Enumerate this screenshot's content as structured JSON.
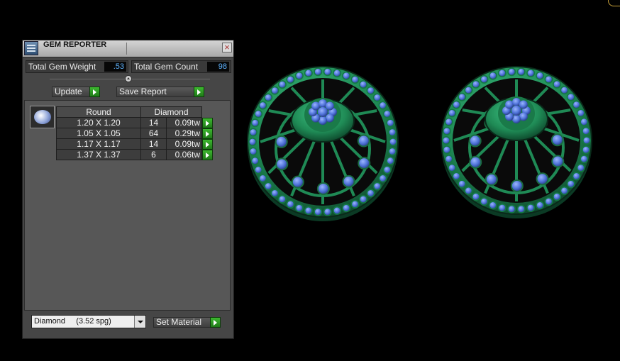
{
  "panel": {
    "title": "GEM REPORTER",
    "total_weight_label": "Total Gem Weight",
    "total_weight_value": ".53",
    "total_count_label": "Total Gem Count",
    "total_count_value": "98",
    "update_label": "Update",
    "save_report_label": "Save Report",
    "table": {
      "headers": [
        "Round",
        "Diamond"
      ],
      "rows": [
        {
          "size": "1.20 X 1.20",
          "count": "14",
          "weight": "0.09tw"
        },
        {
          "size": "1.05 X 1.05",
          "count": "64",
          "weight": "0.29tw"
        },
        {
          "size": "1.17 X 1.17",
          "count": "14",
          "weight": "0.09tw"
        },
        {
          "size": "1.37 X 1.37",
          "count": "6",
          "weight": "0.06tw"
        }
      ]
    },
    "material_select_value": "Diamond     (3.52 spg)",
    "set_material_label": "Set Material"
  },
  "colors": {
    "metal": "#1f8a55",
    "gem": "#4f73d9",
    "value_text": "#5fb4ff",
    "go_button": "#2e9e24"
  }
}
